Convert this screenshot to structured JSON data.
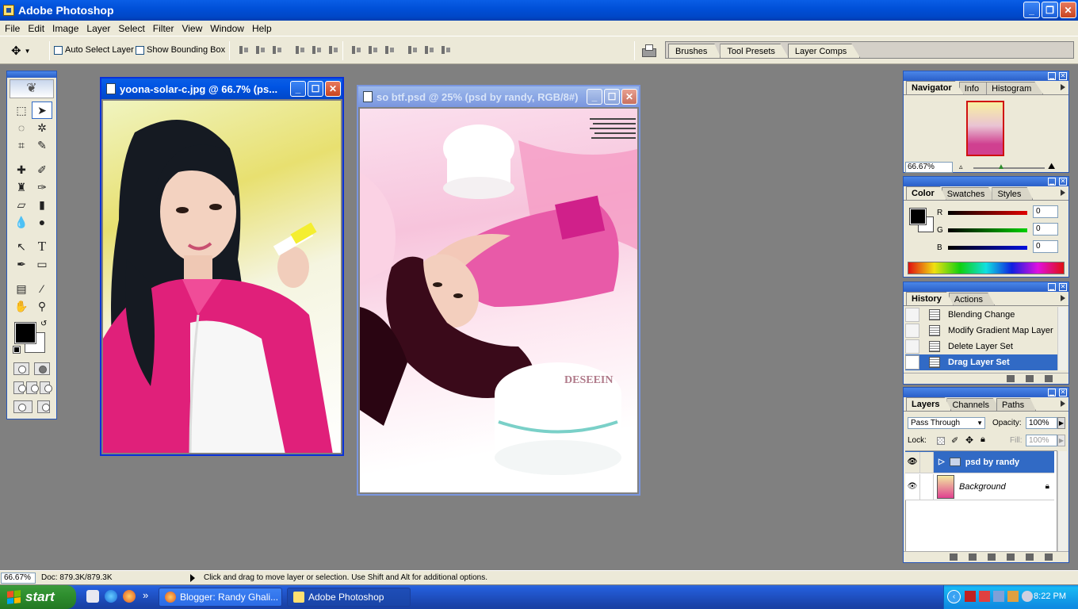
{
  "app": {
    "title": "Adobe Photoshop"
  },
  "menu": [
    "File",
    "Edit",
    "Image",
    "Layer",
    "Select",
    "Filter",
    "View",
    "Window",
    "Help"
  ],
  "options": {
    "auto_select": "Auto Select Layer",
    "bounding_box": "Show Bounding Box",
    "well_tabs": [
      "Brushes",
      "Tool Presets",
      "Layer Comps"
    ]
  },
  "docs": [
    {
      "title": "yoona-solar-c.jpg @ 66.7% (ps..."
    },
    {
      "title": "so btf.psd @ 25% (psd by randy, RGB/8#)",
      "watermark": "DESEEIN"
    }
  ],
  "navigator": {
    "tabs": [
      "Navigator",
      "Info",
      "Histogram"
    ],
    "zoom": "66.67%"
  },
  "color": {
    "tabs": [
      "Color",
      "Swatches",
      "Styles"
    ],
    "channels": [
      {
        "label": "R",
        "value": "0",
        "color": "#d02020"
      },
      {
        "label": "G",
        "value": "0",
        "color": "#20b020"
      },
      {
        "label": "B",
        "value": "0",
        "color": "#2030c0"
      }
    ]
  },
  "history": {
    "tabs": [
      "History",
      "Actions"
    ],
    "items": [
      "Blending Change",
      "Modify Gradient Map Layer",
      "Delete Layer Set",
      "Drag Layer Set"
    ]
  },
  "layers": {
    "tabs": [
      "Layers",
      "Channels",
      "Paths"
    ],
    "blend": "Pass Through",
    "opacity_label": "Opacity:",
    "opacity": "100%",
    "lock_label": "Lock:",
    "fill_label": "Fill:",
    "fill": "100%",
    "items": [
      "psd by randy",
      "Background"
    ]
  },
  "status": {
    "zoom": "66.67%",
    "doc": "Doc: 879.3K/879.3K",
    "message": "Click and drag to move layer or selection.  Use Shift and Alt for additional options."
  },
  "taskbar": {
    "start": "start",
    "overflow": "»",
    "buttons": [
      "Blogger: Randy Ghali...",
      "Adobe Photoshop"
    ],
    "clock": "8:22 PM"
  },
  "colors": {
    "xp_blue": "#0054e3",
    "selection": "#316ac5",
    "panel": "#ece9d8"
  },
  "icons": [
    "move-tool-icon",
    "marquee-icon",
    "lasso-icon",
    "magic-wand-icon",
    "crop-icon",
    "eyedropper-icon",
    "hand-icon",
    "zoom-icon",
    "type-icon"
  ]
}
